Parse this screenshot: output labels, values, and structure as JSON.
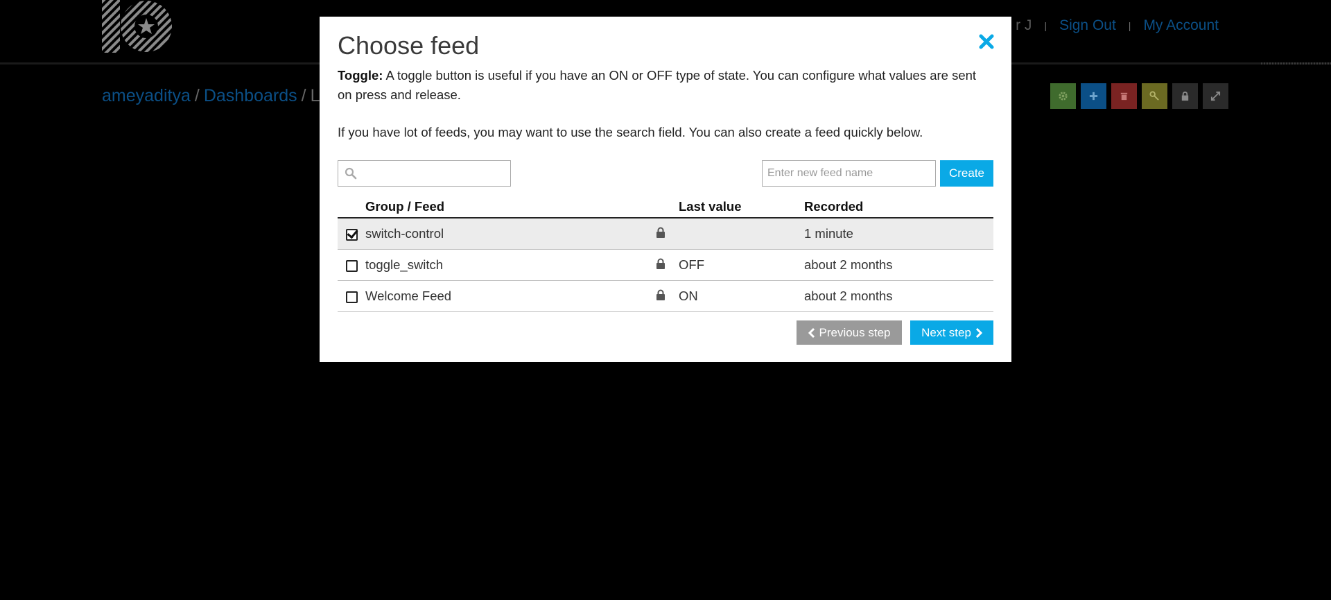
{
  "header": {
    "user_name_partial": "r J",
    "separator": "|",
    "sign_out": "Sign Out",
    "my_account": "My Account"
  },
  "breadcrumb": {
    "user": "ameyaditya",
    "section": "Dashboards",
    "current_partial": "L",
    "separator": "/"
  },
  "dashboard_tools": [
    {
      "icon": "gear-icon",
      "color": "#3f6b2d"
    },
    {
      "icon": "plus-icon",
      "color": "#0b4f86"
    },
    {
      "icon": "trash-icon",
      "color": "#7a2322"
    },
    {
      "icon": "key-icon",
      "color": "#6b6a22"
    },
    {
      "icon": "lock-icon",
      "color": "#2a2a2a"
    },
    {
      "icon": "expand-icon",
      "color": "#2a2a2a"
    }
  ],
  "modal": {
    "title": "Choose feed",
    "toggle_label": "Toggle:",
    "toggle_desc": "A toggle button is useful if you have an ON or OFF type of state. You can configure what values are sent on press and release.",
    "search_hint": "If you have lot of feeds, you may want to use the search field. You can also create a feed quickly below.",
    "search_value": "",
    "new_feed_placeholder": "Enter new feed name",
    "create_label": "Create",
    "columns": {
      "group_feed": "Group / Feed",
      "last_value": "Last value",
      "recorded": "Recorded"
    },
    "feeds": [
      {
        "name": "switch-control",
        "last_value": "",
        "recorded": "1 minute",
        "checked": true
      },
      {
        "name": "toggle_switch",
        "last_value": "OFF",
        "recorded": "about 2 months",
        "checked": false
      },
      {
        "name": "Welcome Feed",
        "last_value": "ON",
        "recorded": "about 2 months",
        "checked": false
      }
    ],
    "prev_label": "Previous step",
    "next_label": "Next step"
  },
  "colors": {
    "accent": "#0aa9e6",
    "background": "#000000",
    "dim_link": "#0b4f86"
  }
}
